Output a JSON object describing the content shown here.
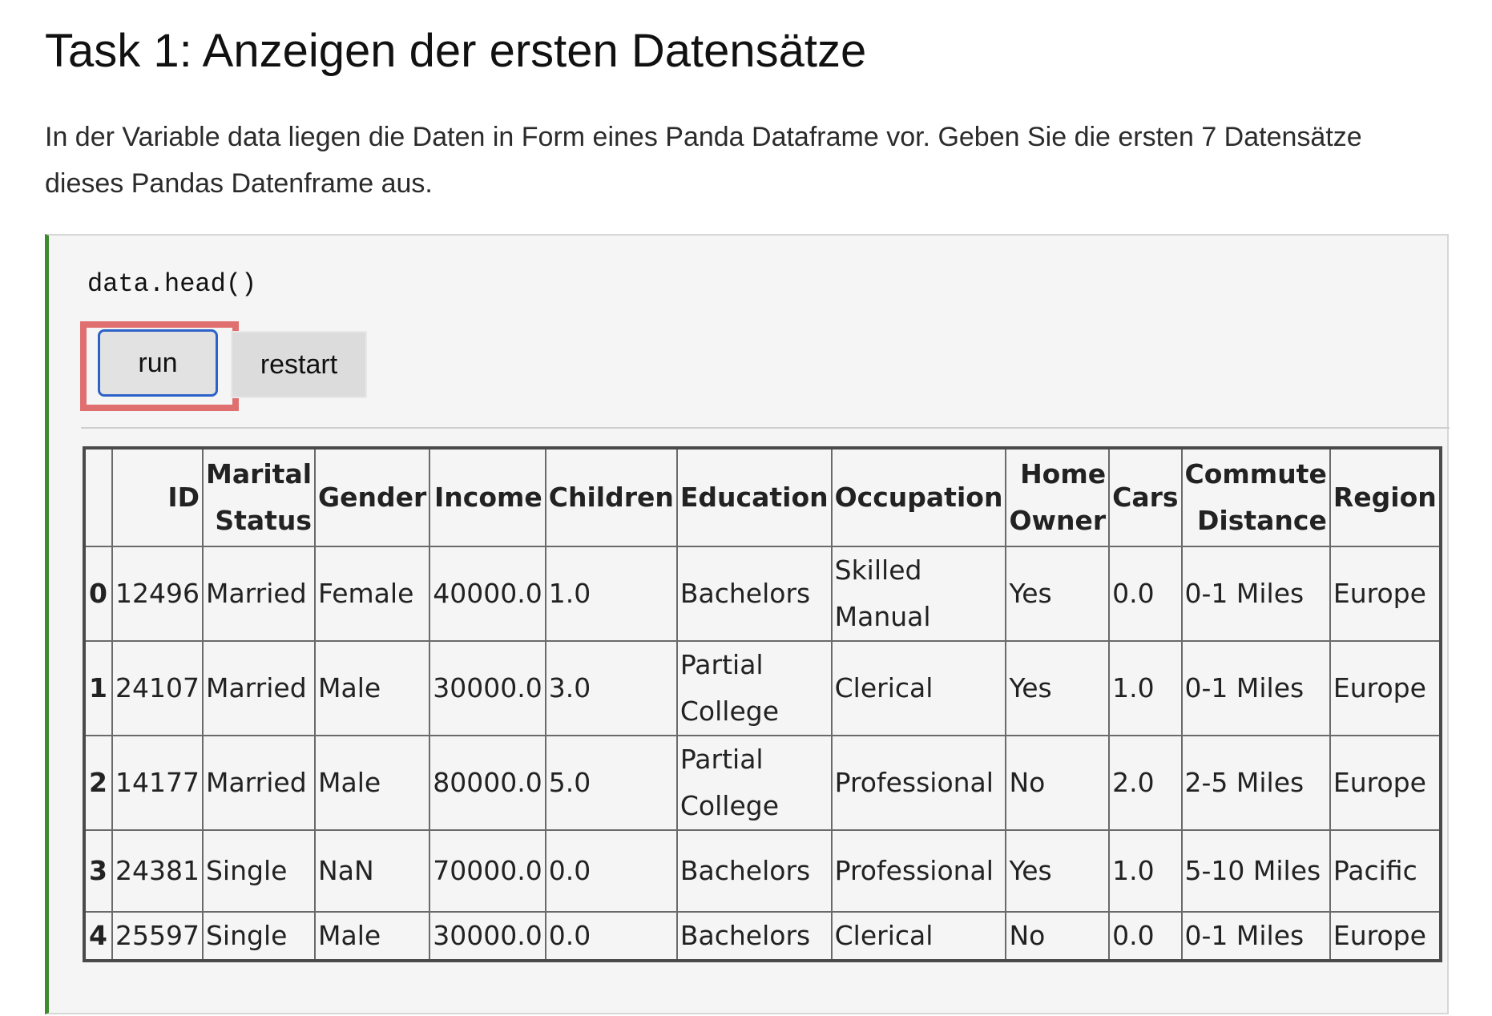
{
  "task": {
    "title": "Task 1: Anzeigen der ersten Datensätze",
    "description": "In der Variable data liegen die Daten in Form eines Panda Dataframe vor. Geben Sie die ersten 7 Datensätze dieses Pandas Datenframe aus."
  },
  "cell": {
    "code": "data.head()",
    "run_label": "run",
    "restart_label": "restart"
  },
  "colors": {
    "cell_border_accent": "#3d8b2f",
    "highlight": "#e07070",
    "run_focus": "#2d62c8"
  },
  "table": {
    "columns": [
      "",
      "ID",
      "Marital Status",
      "Gender",
      "Income",
      "Children",
      "Education",
      "Occupation",
      "Home Owner",
      "Cars",
      "Commute Distance",
      "Region"
    ],
    "rows": [
      {
        "index": "0",
        "cells": [
          "12496",
          "Married",
          "Female",
          "40000.0",
          "1.0",
          "Bachelors",
          "Skilled Manual",
          "Yes",
          "0.0",
          "0-1 Miles",
          "Europe"
        ]
      },
      {
        "index": "1",
        "cells": [
          "24107",
          "Married",
          "Male",
          "30000.0",
          "3.0",
          "Partial College",
          "Clerical",
          "Yes",
          "1.0",
          "0-1 Miles",
          "Europe"
        ]
      },
      {
        "index": "2",
        "cells": [
          "14177",
          "Married",
          "Male",
          "80000.0",
          "5.0",
          "Partial College",
          "Professional",
          "No",
          "2.0",
          "2-5 Miles",
          "Europe"
        ]
      },
      {
        "index": "3",
        "cells": [
          "24381",
          "Single",
          "NaN",
          "70000.0",
          "0.0",
          "Bachelors",
          "Professional",
          "Yes",
          "1.0",
          "5-10 Miles",
          "Pacific"
        ]
      },
      {
        "index": "4",
        "cells": [
          "25597",
          "Single",
          "Male",
          "30000.0",
          "0.0",
          "Bachelors",
          "Clerical",
          "No",
          "0.0",
          "0-1 Miles",
          "Europe"
        ]
      }
    ]
  }
}
